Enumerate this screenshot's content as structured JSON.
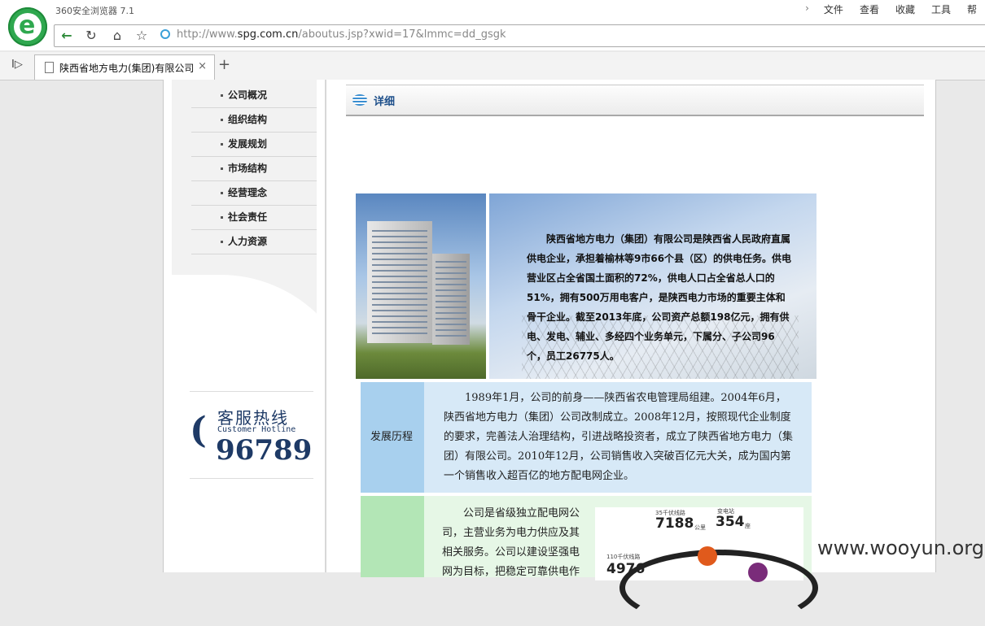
{
  "browser": {
    "title": "360安全浏览器 7.1",
    "menus": [
      "文件",
      "查看",
      "收藏",
      "工具",
      "帮"
    ],
    "url_host_prefix": "http://www.",
    "url_host": "spg.com.cn",
    "url_path": "/aboutus.jsp?xwid=17&lmmc=dd_gsgk",
    "tab_title": "陕西省地方电力(集团)有限公司"
  },
  "sidebar": {
    "items": [
      {
        "label": "公司概况"
      },
      {
        "label": "组织结构"
      },
      {
        "label": "发展规划"
      },
      {
        "label": "市场结构"
      },
      {
        "label": "经营理念"
      },
      {
        "label": "社会责任"
      },
      {
        "label": "人力资源"
      }
    ],
    "hotline": {
      "title": "客服热线",
      "subtitle": "Customer Hotline",
      "number": "96789"
    }
  },
  "content": {
    "header": "详细",
    "intro": "陕西省地方电力（集团）有限公司是陕西省人民政府直属供电企业，承担着榆林等9市66个县（区）的供电任务。供电营业区占全省国土面积的72%，供电人口占全省总人口的51%，拥有500万用电客户，是陕西电力市场的重要主体和骨干企业。截至2013年底，公司资产总额198亿元，拥有供电、发电、辅业、多经四个业务单元，下属分、子公司96个，员工26775人。",
    "history_label": "发展历程",
    "history_text": "1989年1月，公司的前身——陕西省农电管理局组建。2004年6月，陕西省地方电力（集团）公司改制成立。2008年12月，按照现代企业制度的要求，完善法人治理结构，引进战略投资者，成立了陕西省地方电力（集团）有限公司。2010年12月，公司销售收入突破百亿元大关，成为国内第一个销售收入超百亿的地方配电网企业。",
    "business_text": "公司是省级独立配电网公司，主营业务为电力供应及其相关服务。公司以建设坚强电网为目标，把稳定可靠供电作",
    "stats": {
      "s35_label": "35千伏线路",
      "s35_value": "7188",
      "s35_unit": "公里",
      "sub_label": "变电站",
      "sub_value": "354",
      "sub_unit": "座",
      "s110_label": "110千伏线路",
      "s110_value": "4976"
    }
  },
  "watermark": "www.wooyun.org"
}
